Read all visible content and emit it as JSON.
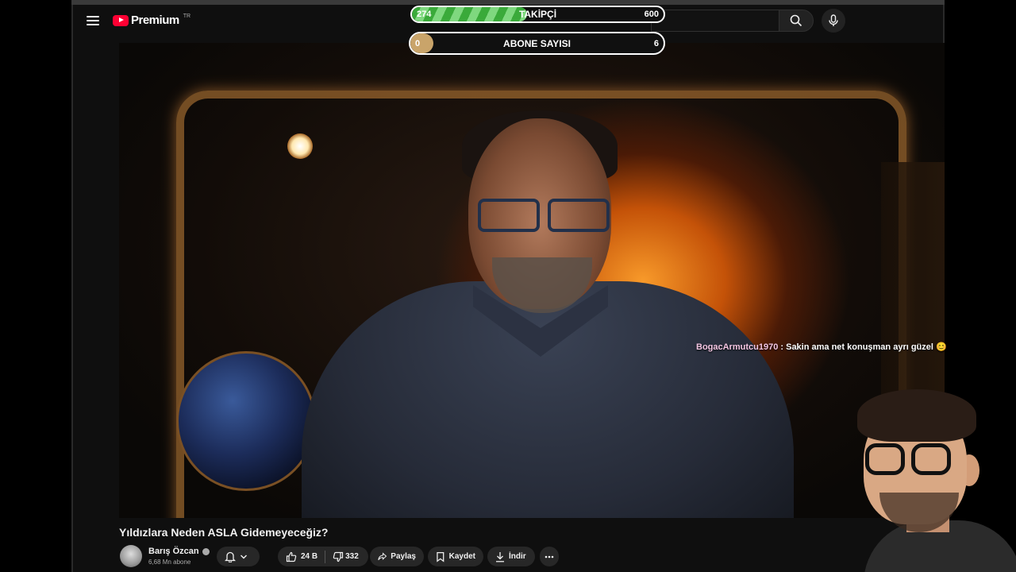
{
  "header": {
    "logo_text": "Premium",
    "logo_region": "TR"
  },
  "overlay": {
    "followers": {
      "current": "274",
      "label": "TAKİPÇİ",
      "goal": "600",
      "progress": 0.457
    },
    "subscribers": {
      "current": "0",
      "label": "ABONE SAYISI",
      "goal": "6",
      "progress": 0.0
    }
  },
  "chat": {
    "user": "BogacArmutcu1970",
    "message": " : Sakin ama net konuşman ayrı güzel 😊"
  },
  "video": {
    "title": "Yıldızlara Neden ASLA Gidemeyeceğiz?",
    "channel": "Barış Özcan",
    "subscribers": "6,68 Mn abone",
    "likes": "24 B",
    "dislikes": "332",
    "share_label": "Paylaş",
    "save_label": "Kaydet",
    "download_label": "İndir"
  },
  "icons": [
    "menu-icon",
    "youtube-logo-icon",
    "search-icon",
    "mic-icon",
    "bell-icon",
    "chevron-down-icon",
    "thumbs-up-icon",
    "thumbs-down-icon",
    "share-icon",
    "bookmark-icon",
    "download-icon",
    "more-icon",
    "verified-icon"
  ],
  "colors": {
    "brand": "#ff0033",
    "progress_green": "#3aaa3a",
    "progress_tan": "#c9a46a"
  }
}
